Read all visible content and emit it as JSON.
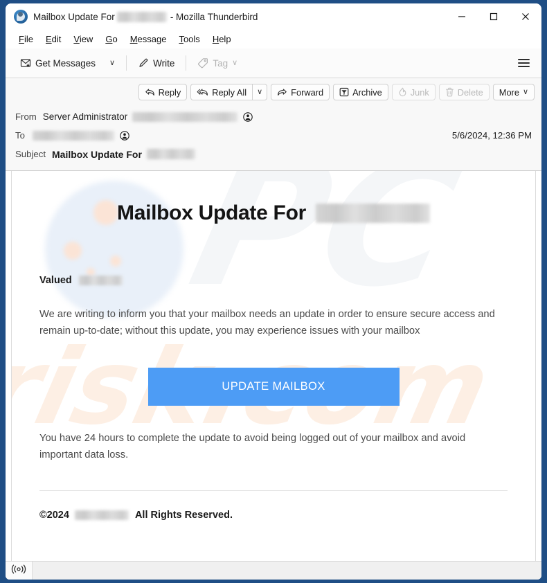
{
  "window": {
    "app_name": "Mozilla Thunderbird",
    "title_prefix": "Mailbox Update For",
    "title_separator": "- Mozilla Thunderbird",
    "app_icon": "thunderbird-icon",
    "controls": {
      "minimize": "—",
      "maximize": "□",
      "close": "✕"
    },
    "border_color": "#1f4e85"
  },
  "menubar": {
    "items": [
      {
        "accesskey": "F",
        "rest": "ile"
      },
      {
        "accesskey": "E",
        "rest": "dit"
      },
      {
        "accesskey": "V",
        "rest": "iew"
      },
      {
        "accesskey": "G",
        "rest": "o"
      },
      {
        "accesskey": "M",
        "rest": "essage"
      },
      {
        "accesskey": "T",
        "rest": "ools"
      },
      {
        "accesskey": "H",
        "rest": "elp"
      }
    ]
  },
  "toolbar": {
    "get_messages_label": "Get Messages",
    "get_messages_icon": "inbox-download-icon",
    "get_messages_chevron": "∨",
    "write_label": "Write",
    "write_icon": "pencil-icon",
    "tag_label": "Tag",
    "tag_icon": "tag-icon",
    "tag_chevron": "∨",
    "app_menu_icon": "hamburger-menu-icon"
  },
  "message_actions": {
    "reply_label": "Reply",
    "reply_icon": "reply-arrow-icon",
    "reply_all_label": "Reply All",
    "reply_all_icon": "reply-all-arrow-icon",
    "reply_all_chevron": "∨",
    "forward_label": "Forward",
    "forward_icon": "forward-arrow-icon",
    "archive_label": "Archive",
    "archive_icon": "archive-box-icon",
    "junk_label": "Junk",
    "junk_icon": "flame-icon",
    "delete_label": "Delete",
    "delete_icon": "trash-icon",
    "more_label": "More",
    "more_chevron": "∨"
  },
  "message_header": {
    "from_label": "From",
    "from_name": "Server Administrator",
    "from_address_redacted": true,
    "to_label": "To",
    "to_address_redacted": true,
    "subject_label": "Subject",
    "subject_text": "Mailbox Update For",
    "subject_redacted": true,
    "date": "5/6/2024, 12:36 PM",
    "contact_icon": "contact-person-icon"
  },
  "email_body": {
    "heading": "Mailbox Update For",
    "heading_redacted_domain": true,
    "greeting": "Valued",
    "greeting_redacted": true,
    "paragraph_1": "We are writing to inform you that your mailbox needs an update in order to ensure secure access and remain up-to-date; without this update, you may experience issues with your mailbox",
    "cta_label": "UPDATE MAILBOX",
    "cta_color": "#4d9cf5",
    "paragraph_2": "You have 24 hours to complete the update to avoid being logged out of your mailbox and avoid important data loss.",
    "copyright_year": "©2024",
    "copyright_redacted": true,
    "rights_text": "All Rights Reserved."
  },
  "watermark": {
    "top_text": "PC",
    "bottom_text": "risk.com",
    "blob_color": "#e9f0f9",
    "dot_color": "#fbe4d6"
  },
  "statusbar": {
    "online_indicator_label": "((o))",
    "online_icon": "online-status-icon"
  }
}
